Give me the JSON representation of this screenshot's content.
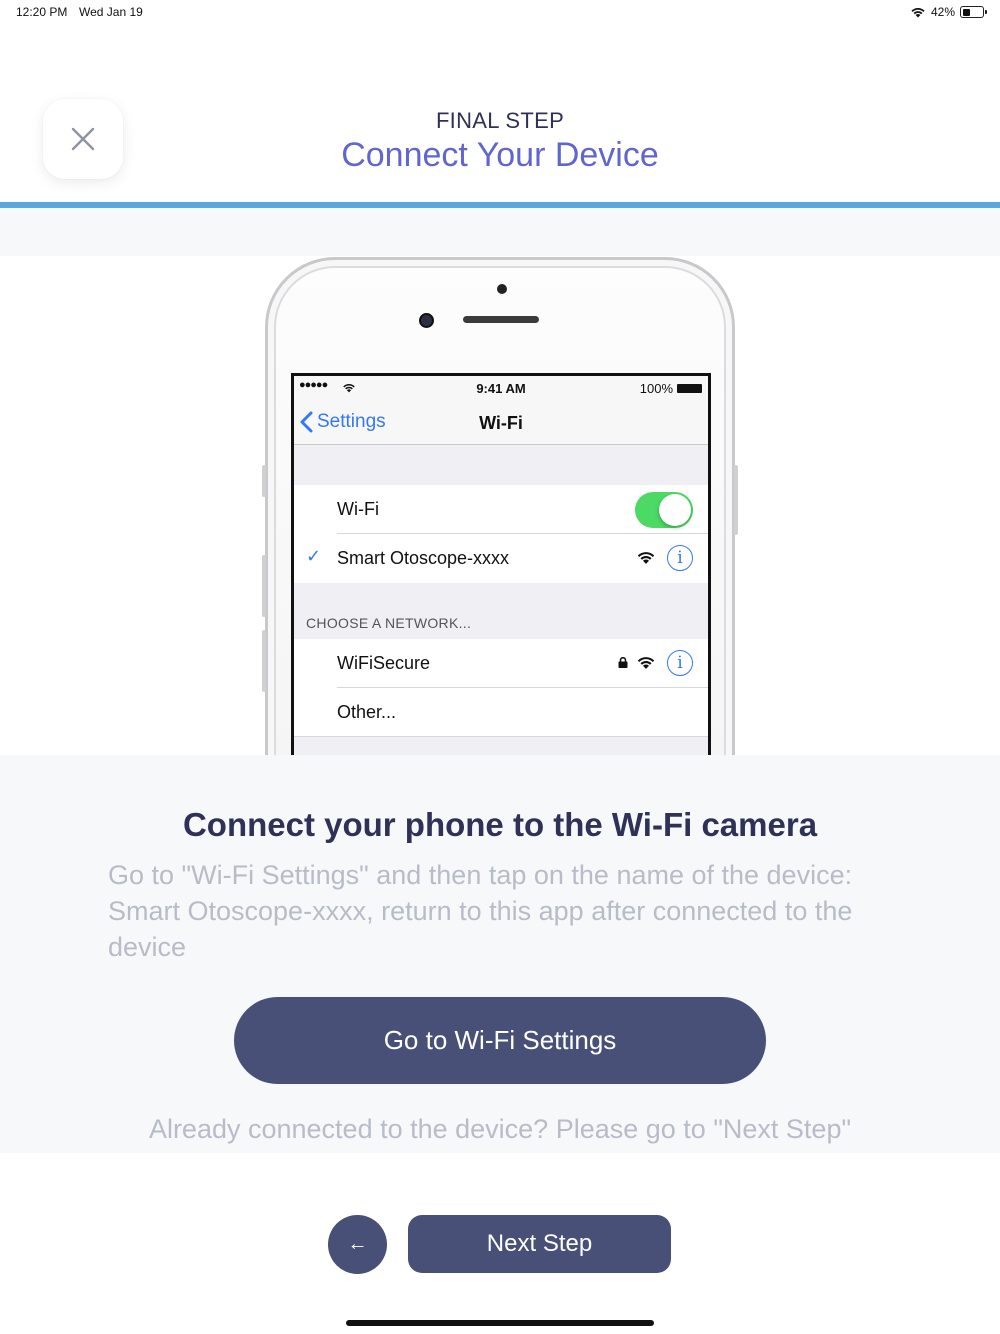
{
  "status_bar": {
    "time": "12:20 PM",
    "date": "Wed Jan 19",
    "battery_text": "42%",
    "battery_level": 0.42
  },
  "header": {
    "step_label": "FINAL STEP",
    "title": "Connect Your Device",
    "close_icon": "close-icon",
    "accent": "#6166cf",
    "progress_color": "#5aa6df"
  },
  "illustration": {
    "status_dots": "●●●●●",
    "status_time": "9:41 AM",
    "status_battery": "100%",
    "back_label": "Settings",
    "nav_title": "Wi-Fi",
    "wifi_label": "Wi-Fi",
    "wifi_toggle_on": true,
    "connected_network": "Smart Otoscope-xxxx",
    "section_header": "CHOOSE A NETWORK...",
    "networks": [
      {
        "name": "WiFiSecure",
        "secured": true
      },
      {
        "name": "Other..."
      }
    ]
  },
  "content": {
    "heading": "Connect your phone to the Wi-Fi camera",
    "description": "Go to \"Wi-Fi Settings\" and then tap on the name of the device: Smart Otoscope-xxxx, return to this app after connected to the device",
    "wifi_settings_button": "Go to Wi-Fi Settings",
    "already_connected_text": "Already connected to the device? Please go to \"Next Step\""
  },
  "footer": {
    "back_button": "←",
    "next_button": "Next Step",
    "button_color": "#485078"
  }
}
